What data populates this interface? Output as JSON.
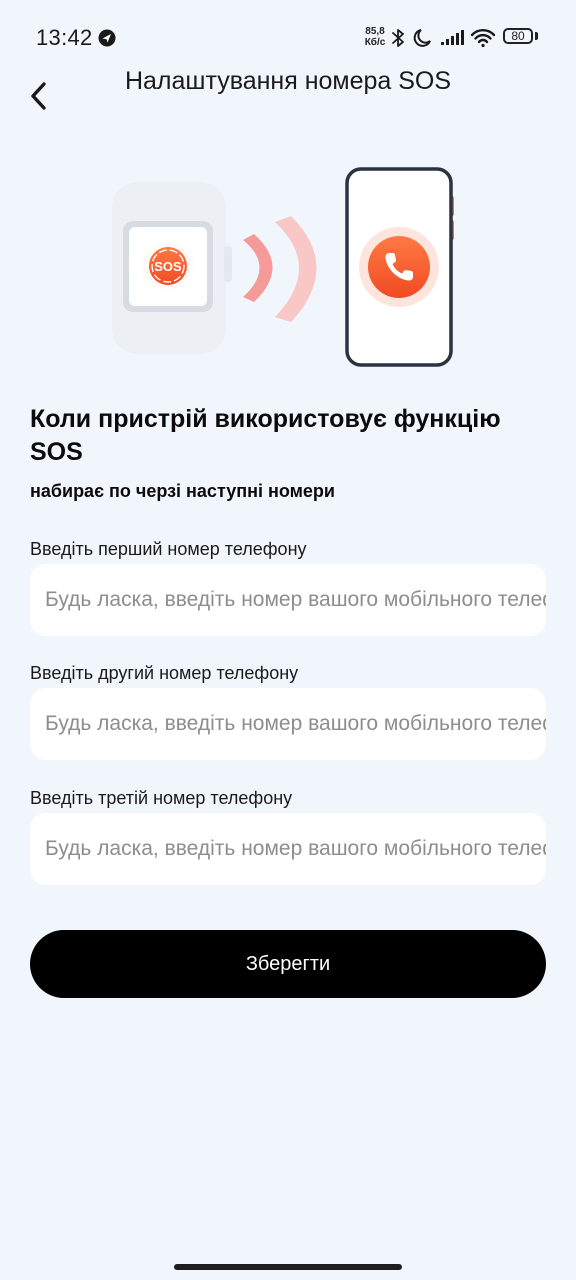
{
  "status_bar": {
    "time": "13:42",
    "network_speed_value": "85,8",
    "network_speed_unit": "Кб/с",
    "battery_level": "80",
    "icons": [
      "navigation-icon",
      "bluetooth-icon",
      "do-not-disturb-moon-icon",
      "signal-icon",
      "wifi-icon",
      "battery-icon"
    ]
  },
  "header": {
    "title": "Налаштування номера SOS",
    "back_icon": "chevron-left-icon"
  },
  "illustration": {
    "watch_badge_text": "SOS",
    "accent_color": "#f05a2c",
    "signal_color": "#f28b8b",
    "phone_icon": "phone-call-icon"
  },
  "content": {
    "heading": "Коли пристрій використовує функцію SOS",
    "subheading": "набирає по черзі наступні номери"
  },
  "fields": [
    {
      "label": "Введіть перший номер телефону",
      "placeholder": "Будь ласка, введіть номер вашого мобільного телефону",
      "value": ""
    },
    {
      "label": "Введіть другий номер телефону",
      "placeholder": "Будь ласка, введіть номер вашого мобільного телефону",
      "value": ""
    },
    {
      "label": "Введіть третій номер телефону",
      "placeholder": "Будь ласка, введіть номер вашого мобільного телефону",
      "value": ""
    }
  ],
  "actions": {
    "save_label": "Зберегти"
  },
  "colors": {
    "background": "#f1f6fd",
    "button": "#000000",
    "button_text": "#ffffff",
    "input_bg": "#ffffff",
    "placeholder": "#8d8d8d"
  }
}
